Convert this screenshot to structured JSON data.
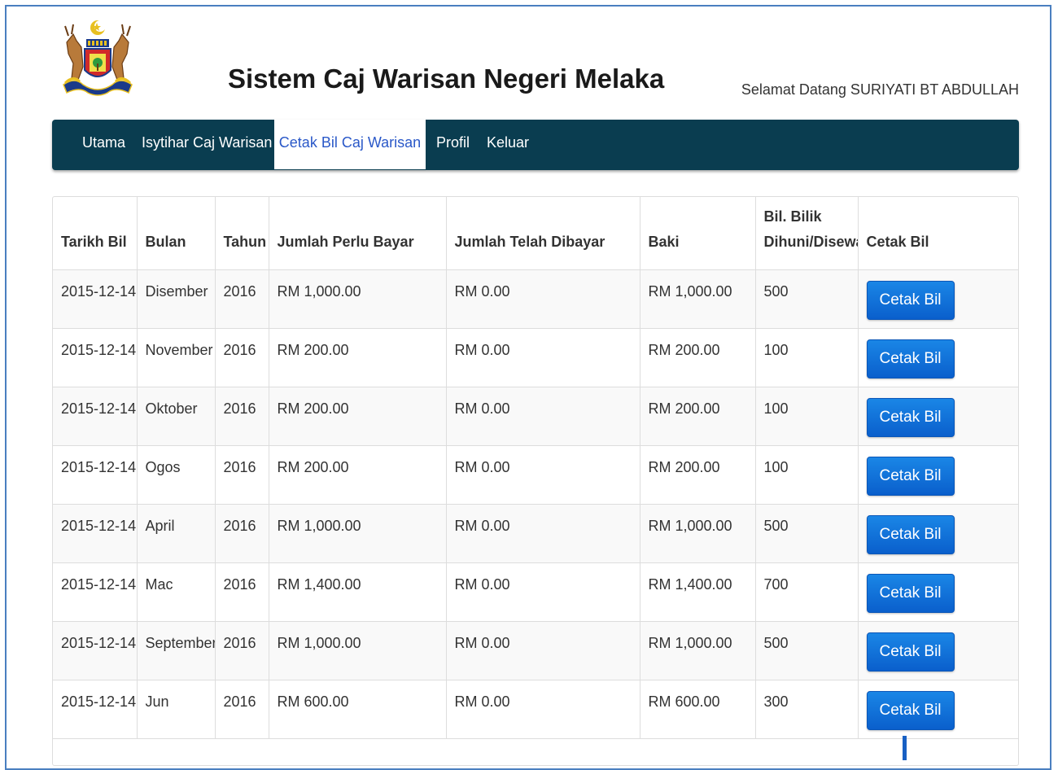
{
  "header": {
    "app_title": "Sistem Caj Warisan Negeri Melaka",
    "welcome_text": "Selamat Datang SURIYATI BT ABDULLAH"
  },
  "nav": {
    "items": [
      {
        "label": "Utama"
      },
      {
        "label": "Isytihar Caj Warisan"
      },
      {
        "label": "Cetak Bil Caj Warisan"
      },
      {
        "label": "Profil"
      },
      {
        "label": "Keluar"
      }
    ],
    "active_index": 2
  },
  "table": {
    "columns": [
      "Tarikh Bil",
      "Bulan",
      "Tahun",
      "Jumlah Perlu Bayar",
      "Jumlah Telah Dibayar",
      "Baki",
      "Bil. Bilik Dihuni/Disewa",
      "Cetak Bil"
    ],
    "button_label": "Cetak Bil",
    "rows": [
      [
        "2015-12-14",
        "Disember",
        "2016",
        "RM 1,000.00",
        "RM 0.00",
        "RM 1,000.00",
        "500"
      ],
      [
        "2015-12-14",
        "November",
        "2016",
        "RM 200.00",
        "RM 0.00",
        "RM 200.00",
        "100"
      ],
      [
        "2015-12-14",
        "Oktober",
        "2016",
        "RM 200.00",
        "RM 0.00",
        "RM 200.00",
        "100"
      ],
      [
        "2015-12-14",
        "Ogos",
        "2016",
        "RM 200.00",
        "RM 0.00",
        "RM 200.00",
        "100"
      ],
      [
        "2015-12-14",
        "April",
        "2016",
        "RM 1,000.00",
        "RM 0.00",
        "RM 1,000.00",
        "500"
      ],
      [
        "2015-12-14",
        "Mac",
        "2016",
        "RM 1,400.00",
        "RM 0.00",
        "RM 1,400.00",
        "700"
      ],
      [
        "2015-12-14",
        "September",
        "2016",
        "RM 1,000.00",
        "RM 0.00",
        "RM 1,000.00",
        "500"
      ],
      [
        "2015-12-14",
        "Jun",
        "2016",
        "RM 600.00",
        "RM 0.00",
        "RM 600.00",
        "300"
      ]
    ]
  },
  "colors": {
    "navbar_bg": "#0a3d50",
    "active_tab_text": "#2a58c8",
    "button_bg": "#0a6fd8",
    "frame_border": "#4a7fc0"
  }
}
